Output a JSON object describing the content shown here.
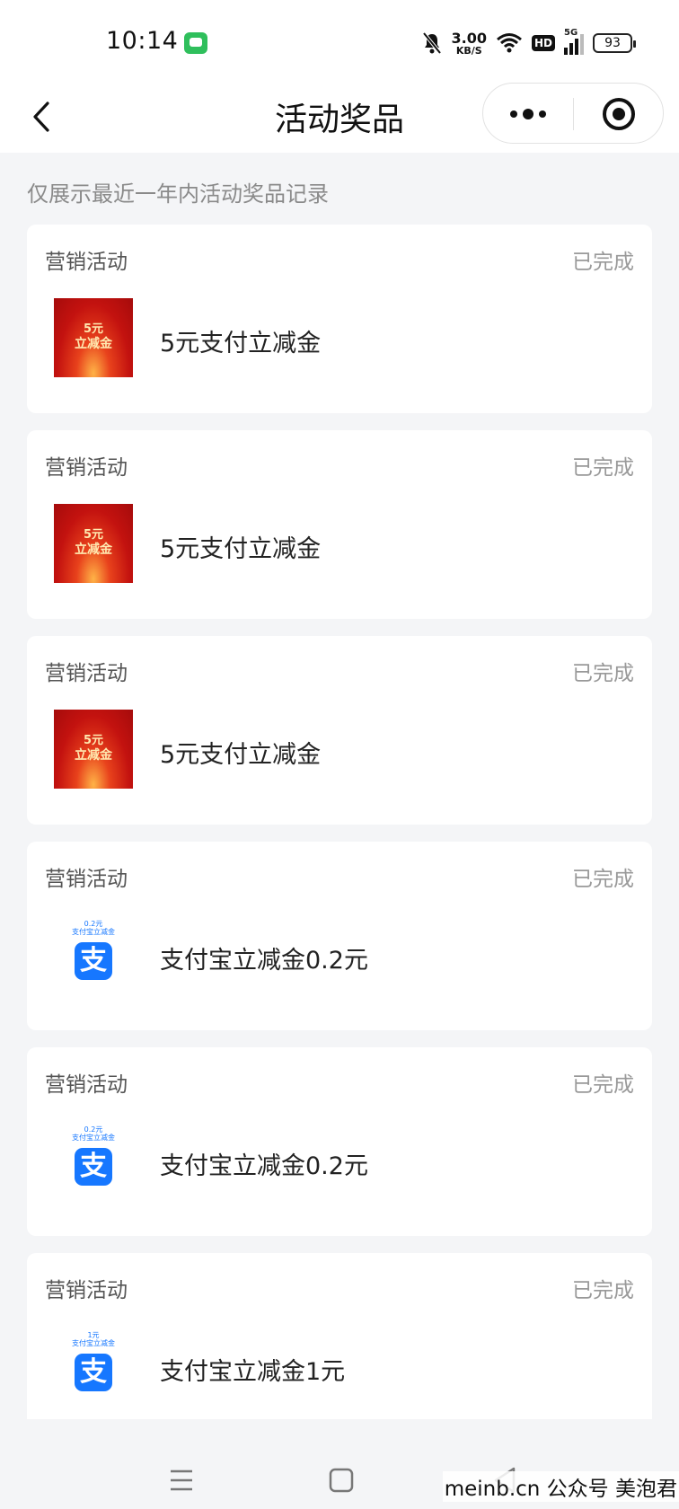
{
  "status_bar": {
    "time": "10:14",
    "net_speed_value": "3.00",
    "net_speed_unit": "KB/S",
    "hd_label": "HD",
    "network_label": "5G",
    "battery": "93"
  },
  "nav": {
    "title": "活动奖品"
  },
  "hint": "仅展示最近一年内活动奖品记录",
  "cards": [
    {
      "category": "营销活动",
      "status": "已完成",
      "name": "5元支付立减金",
      "thumb_line1": "5元",
      "thumb_line2": "立减金"
    },
    {
      "category": "营销活动",
      "status": "已完成",
      "name": "5元支付立减金",
      "thumb_line1": "5元",
      "thumb_line2": "立减金"
    },
    {
      "category": "营销活动",
      "status": "已完成",
      "name": "5元支付立减金",
      "thumb_line1": "5元",
      "thumb_line2": "立减金"
    },
    {
      "category": "营销活动",
      "status": "已完成",
      "name": "支付宝立减金0.2元",
      "thumb_line1": "0.2元",
      "thumb_line2": "支付宝立减金",
      "logo_char": "支"
    },
    {
      "category": "营销活动",
      "status": "已完成",
      "name": "支付宝立减金0.2元",
      "thumb_line1": "0.2元",
      "thumb_line2": "支付宝立减金",
      "logo_char": "支"
    },
    {
      "category": "营销活动",
      "status": "已完成",
      "name": "支付宝立减金1元",
      "thumb_line1": "1元",
      "thumb_line2": "支付宝立减金",
      "logo_char": "支"
    }
  ],
  "watermark": "meinb.cn  公众号 美泡君",
  "colors": {
    "background": "#f4f5f7",
    "card": "#ffffff",
    "alipay_blue": "#1677ff",
    "coupon_red": "#c3120f"
  }
}
